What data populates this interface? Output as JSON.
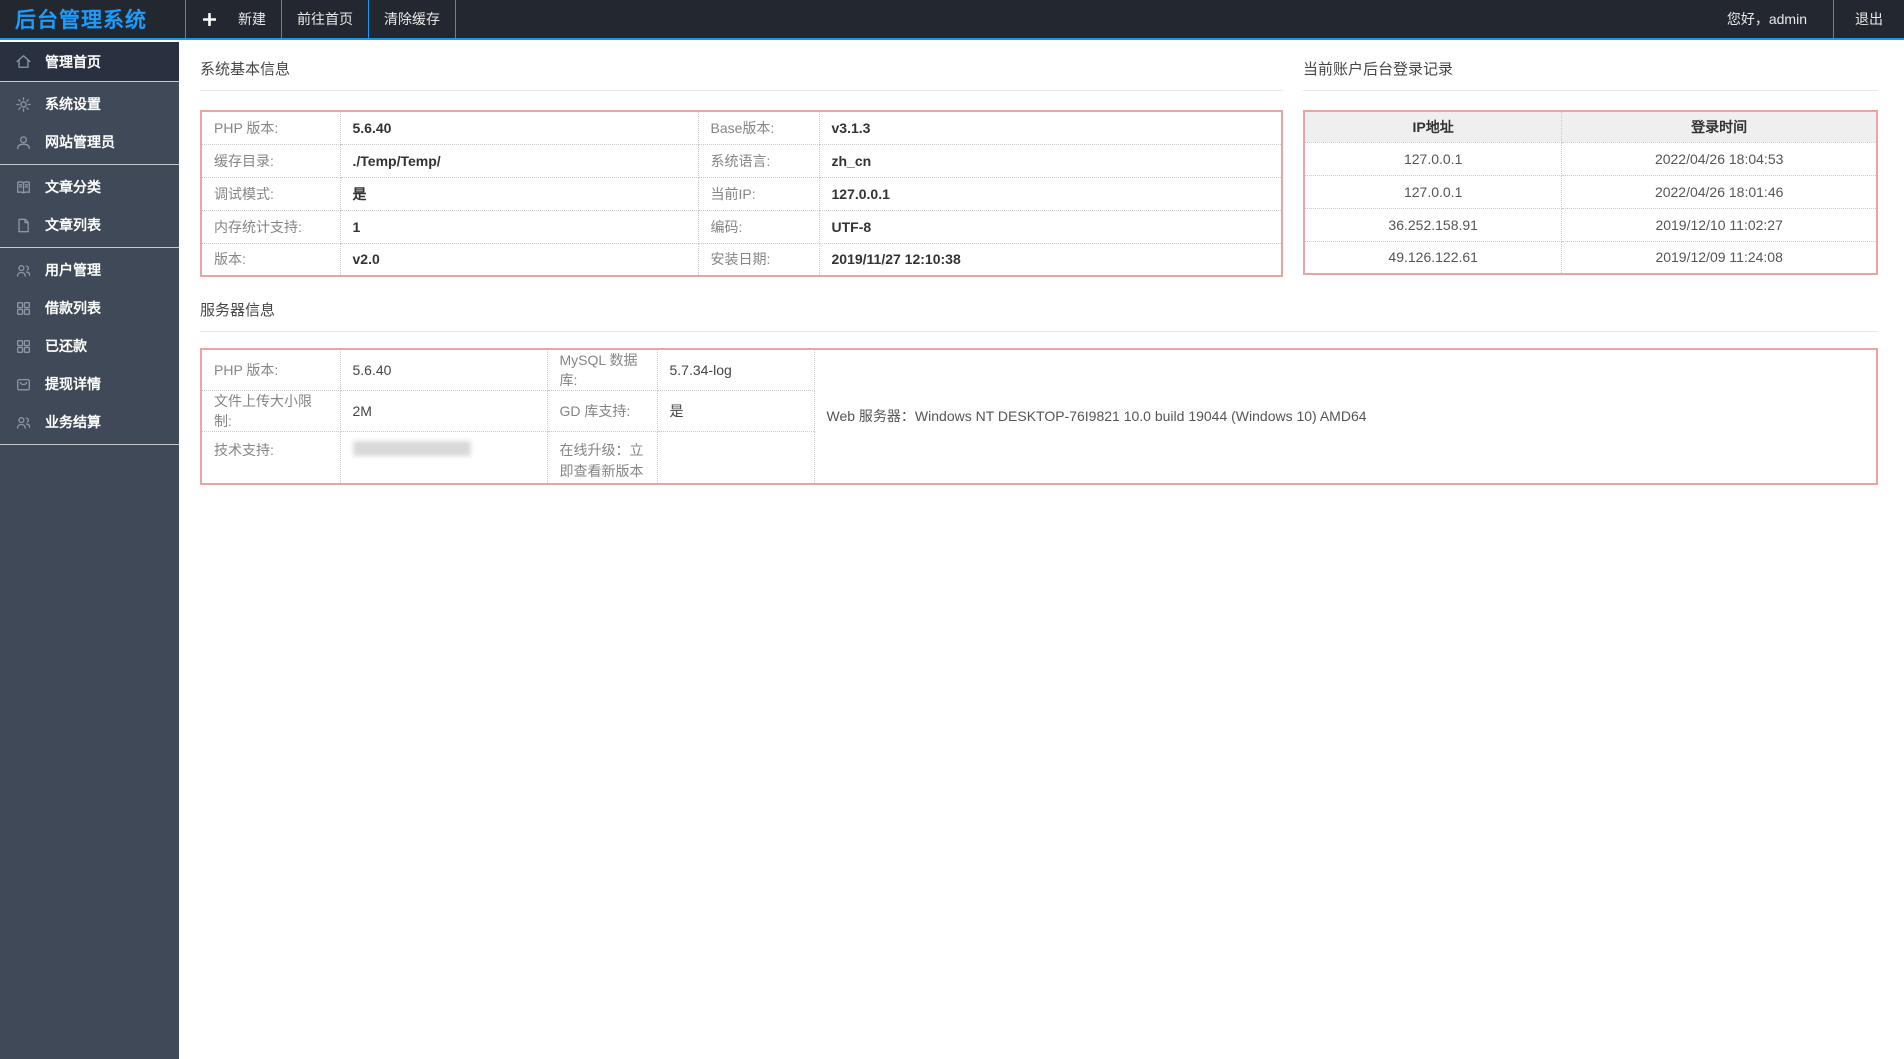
{
  "topbar": {
    "logo": "后台管理系统",
    "new_button": "新建",
    "goto_home_button": "前往首页",
    "clear_cache_button": "清除缓存",
    "greeting": "您好，admin",
    "logout": "退出"
  },
  "sidebar": {
    "items": [
      {
        "icon": "home-icon",
        "label": "管理首页"
      },
      {
        "icon": "gear-icon",
        "label": "系统设置"
      },
      {
        "icon": "user-icon",
        "label": "网站管理员"
      },
      {
        "icon": "book-icon",
        "label": "文章分类"
      },
      {
        "icon": "file-icon",
        "label": "文章列表"
      },
      {
        "icon": "users-icon",
        "label": "用户管理"
      },
      {
        "icon": "grid-icon",
        "label": "借款列表"
      },
      {
        "icon": "grid-icon",
        "label": "已还款"
      },
      {
        "icon": "box-icon",
        "label": "提现详情"
      },
      {
        "icon": "users-icon",
        "label": "业务结算"
      }
    ]
  },
  "sys_info": {
    "title": "系统基本信息",
    "rows": [
      [
        "PHP 版本:",
        "5.6.40",
        "Base版本:",
        "v3.1.3"
      ],
      [
        "缓存目录:",
        "./Temp/Temp/",
        "系统语言:",
        "zh_cn"
      ],
      [
        "调试模式:",
        "是",
        "当前IP:",
        "127.0.0.1"
      ],
      [
        "内存统计支持:",
        "1",
        "编码:",
        "UTF-8"
      ],
      [
        "版本:",
        "v2.0",
        "安装日期:",
        "2019/11/27 12:10:38"
      ]
    ]
  },
  "login_log": {
    "title": "当前账户后台登录记录",
    "headers": [
      "IP地址",
      "登录时间"
    ],
    "rows": [
      [
        "127.0.0.1",
        "2022/04/26 18:04:53"
      ],
      [
        "127.0.0.1",
        "2022/04/26 18:01:46"
      ],
      [
        "36.252.158.91",
        "2019/12/10 11:02:27"
      ],
      [
        "49.126.122.61",
        "2019/12/09 11:24:08"
      ]
    ]
  },
  "server_info": {
    "title": "服务器信息",
    "row1": [
      "PHP 版本:",
      "5.6.40",
      "MySQL 数据库:",
      "5.7.34-log"
    ],
    "row2": [
      "文件上传大小限制:",
      "2M",
      "GD 库支持:",
      "是"
    ],
    "row3_label": "技术支持:",
    "row3_upgrade": "在线升级：立即查看新版本",
    "web_server": "Web 服务器：Windows NT DESKTOP-76I9821 10.0 build 19044 (Windows 10) AMD64"
  },
  "colors": {
    "accent_blue": "#129BF3",
    "logo_blue": "#1B9DFF",
    "topbar_bg": "#23272F",
    "sidebar_bg": "#3F4957",
    "sidebar_active_bg": "#293140",
    "table_border_pink": "#EBA3A3",
    "table_header_bg": "#EFEFEF"
  }
}
